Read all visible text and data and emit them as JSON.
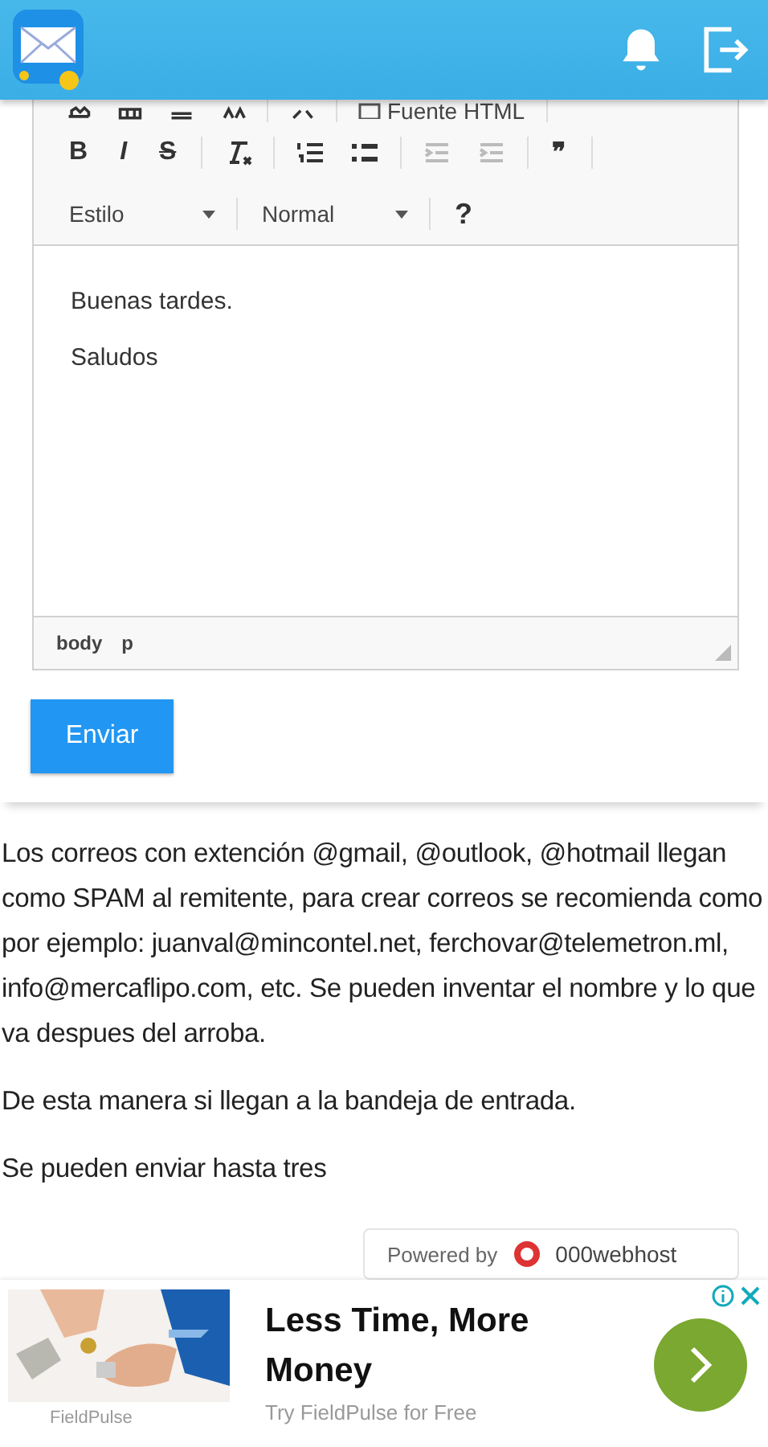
{
  "editor": {
    "toolbar": {
      "source_label": "Fuente HTML",
      "format_buttons": [
        "B",
        "I",
        "S"
      ],
      "indent_buttons": [
        {
          "disabled": true
        },
        {
          "disabled": true
        }
      ],
      "quote": "❞",
      "dropdowns": [
        {
          "label": "Estilo"
        },
        {
          "label": "Normal"
        }
      ],
      "help": "?"
    },
    "content": [
      "Buenas tardes.",
      "Saludos"
    ],
    "path": [
      "body",
      "p"
    ]
  },
  "send_button": "Enviar",
  "info": [
    "Los correos con extención @gmail, @outlook, @hotmail llegan como SPAM al remitente, para crear correos se recomienda como por ejemplo: juanval@mincontel.net, ferchovar@telemetron.ml, info@mercaflipo.com, etc. Se pueden inventar el nombre y lo que va despues del arroba.",
    "De esta manera si llegan a la bandeja de entrada.",
    "Se pueden enviar hasta tres"
  ],
  "powered_badge": {
    "label": "Powered by",
    "brand": "000webhost"
  },
  "ad": {
    "title": "Less Time, More Money",
    "subtitle": "Try FieldPulse for Free",
    "advertiser": "FieldPulse"
  }
}
